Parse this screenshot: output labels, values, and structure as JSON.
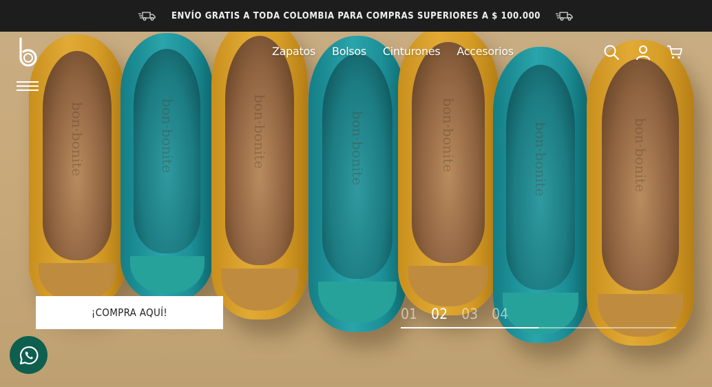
{
  "announcement": {
    "text": "ENVÍO GRATIS A TODA COLOMBIA PARA COMPRAS SUPERIORES A $ 100.000",
    "icon_left": "delivery-truck-icon",
    "icon_right": "delivery-truck-icon"
  },
  "header": {
    "logo_icon": "brand-b-logo",
    "menu_icon": "hamburger-menu-icon",
    "nav": [
      "Zapatos",
      "Bolsos",
      "Cinturones",
      "Accesorios"
    ],
    "icons": [
      "search-icon",
      "user-icon",
      "cart-icon"
    ]
  },
  "hero": {
    "brand_imprint": "bon·bonite",
    "cta_label": "¡COMPRA AQUÍ!",
    "slides": [
      "01",
      "02",
      "03",
      "04"
    ],
    "active_slide": "02",
    "progress_fraction": 0.5
  },
  "colors": {
    "topbar": "#1d1d1d",
    "mustard": "#d69d27",
    "teal": "#1d8f97",
    "whatsapp": "#0f5f4e"
  },
  "floating": {
    "whatsapp_icon": "whatsapp-icon"
  }
}
